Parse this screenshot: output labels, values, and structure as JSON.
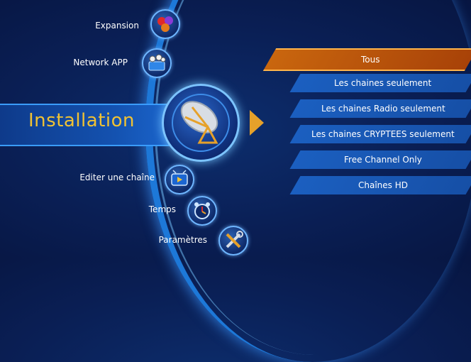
{
  "menu": {
    "items": [
      {
        "label": "Expansion",
        "icon": "expansion-balls-icon"
      },
      {
        "label": "Network APP",
        "icon": "network-app-icon"
      },
      {
        "label": "Installation",
        "icon": "satellite-dish-icon",
        "selected": true
      },
      {
        "label": "Editer une chaîne",
        "icon": "tv-edit-icon"
      },
      {
        "label": "Temps",
        "icon": "alarm-clock-icon"
      },
      {
        "label": "Paramètres",
        "icon": "tools-icon"
      }
    ]
  },
  "submenu": {
    "options": [
      {
        "label": "Tous",
        "selected": true
      },
      {
        "label": "Les chaines seulement"
      },
      {
        "label": "Les chaines Radio seulement"
      },
      {
        "label": "Les chaines CRYPTEES seulement"
      },
      {
        "label": "Free Channel Only"
      },
      {
        "label": "Chaînes HD"
      }
    ]
  },
  "colors": {
    "background": "#0a1f55",
    "selected_text": "#f0c233",
    "selected_option": "#c9660e",
    "option": "#1b5fc0",
    "accent": "#e6a12a"
  }
}
